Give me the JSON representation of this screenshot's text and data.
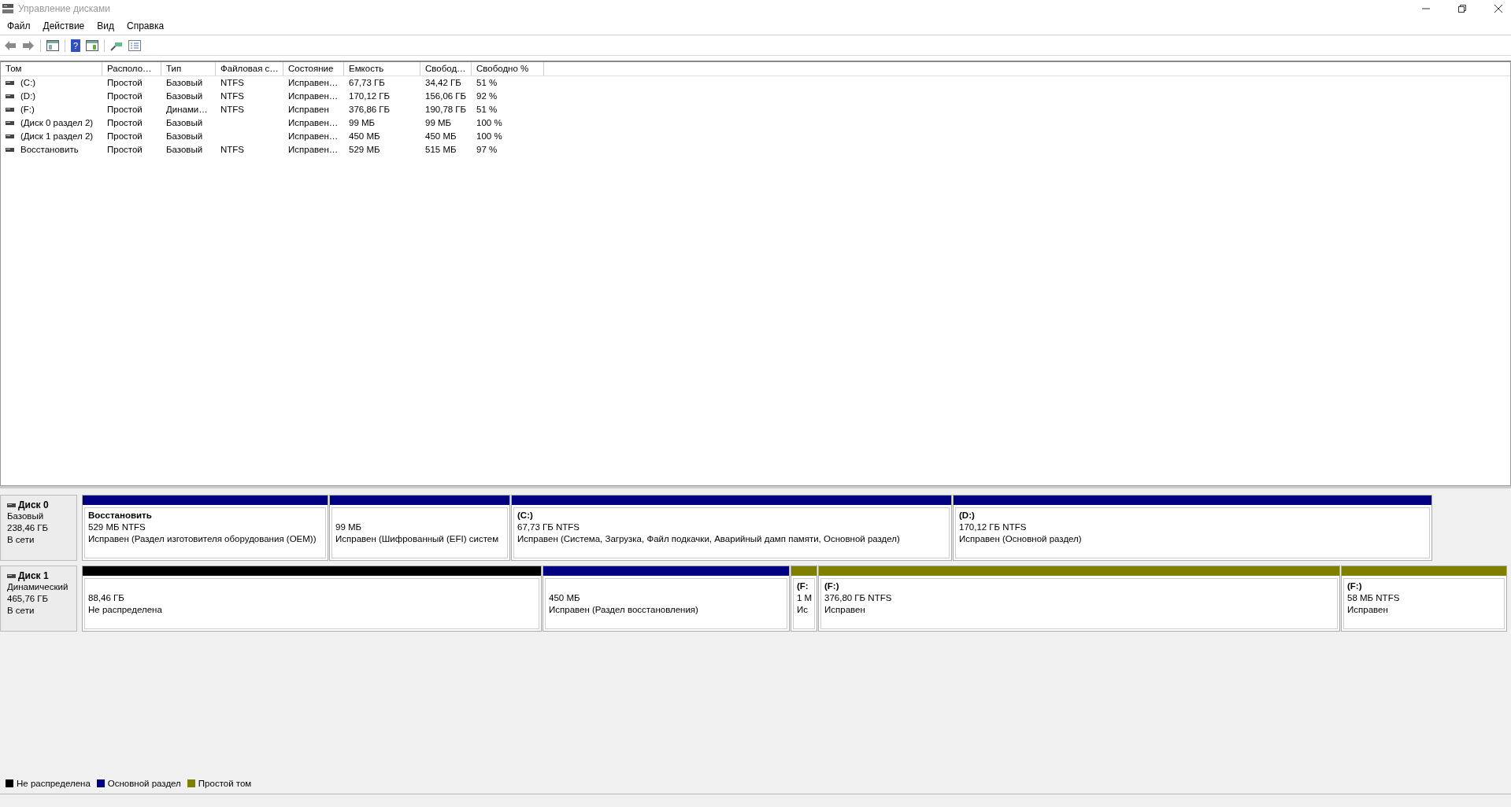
{
  "window": {
    "title": "Управление дисками"
  },
  "menu": [
    "Файл",
    "Действие",
    "Вид",
    "Справка"
  ],
  "toolbar": {
    "help_glyph": "?"
  },
  "table": {
    "columns": [
      "Том",
      "Располо…",
      "Тип",
      "Файловая с…",
      "Состояние",
      "Емкость",
      "Свобод…",
      "Свободно %"
    ],
    "rows": [
      [
        "(C:)",
        "Простой",
        "Базовый",
        "NTFS",
        "Исправен…",
        "67,73 ГБ",
        "34,42 ГБ",
        "51 %"
      ],
      [
        "(D:)",
        "Простой",
        "Базовый",
        "NTFS",
        "Исправен…",
        "170,12 ГБ",
        "156,06 ГБ",
        "92 %"
      ],
      [
        "(F:)",
        "Простой",
        "Динами…",
        "NTFS",
        "Исправен",
        "376,86 ГБ",
        "190,78 ГБ",
        "51 %"
      ],
      [
        "(Диск 0 раздел 2)",
        "Простой",
        "Базовый",
        "",
        "Исправен…",
        "99 МБ",
        "99 МБ",
        "100 %"
      ],
      [
        "(Диск 1 раздел 2)",
        "Простой",
        "Базовый",
        "",
        "Исправен…",
        "450 МБ",
        "450 МБ",
        "100 %"
      ],
      [
        "Восстановить",
        "Простой",
        "Базовый",
        "NTFS",
        "Исправен…",
        "529 МБ",
        "515 МБ",
        "97 %"
      ]
    ]
  },
  "disks": [
    {
      "name": "Диск 0",
      "type": "Базовый",
      "size": "238,46 ГБ",
      "status": "В сети",
      "partitions": [
        {
          "color": "#000080",
          "label": "Восстановить",
          "size": "529 МБ NTFS",
          "status": "Исправен (Раздел изготовителя оборудования (OEM))"
        },
        {
          "color": "#000080",
          "size": "99 МБ",
          "status": "Исправен (Шифрованный (EFI) систем"
        },
        {
          "color": "#000080",
          "label": "(C:)",
          "size": "67,73 ГБ NTFS",
          "status": "Исправен (Система, Загрузка, Файл подкачки, Аварийный дамп памяти, Основной раздел)"
        },
        {
          "color": "#000080",
          "label": "(D:)",
          "size": "170,12 ГБ NTFS",
          "status": "Исправен (Основной раздел)"
        }
      ]
    },
    {
      "name": "Диск 1",
      "type": "Динамический",
      "size": "465,76 ГБ",
      "status": "В сети",
      "partitions": [
        {
          "color": "#000000",
          "size": "88,46 ГБ",
          "status": "Не распределена"
        },
        {
          "color": "#000080",
          "size": "450 МБ",
          "status": "Исправен (Раздел восстановления)"
        },
        {
          "color": "#808000",
          "label": "(F:",
          "size": "1 М",
          "status": "Ис"
        },
        {
          "color": "#808000",
          "label": "(F:)",
          "size": "376,80 ГБ NTFS",
          "status": "Исправен"
        },
        {
          "color": "#808000",
          "label": "(F:)",
          "size": "58 МБ NTFS",
          "status": "Исправен"
        }
      ]
    }
  ],
  "legend": [
    {
      "color": "#000000",
      "label": "Не распределена"
    },
    {
      "color": "#000080",
      "label": "Основной раздел"
    },
    {
      "color": "#808000",
      "label": "Простой том"
    }
  ]
}
